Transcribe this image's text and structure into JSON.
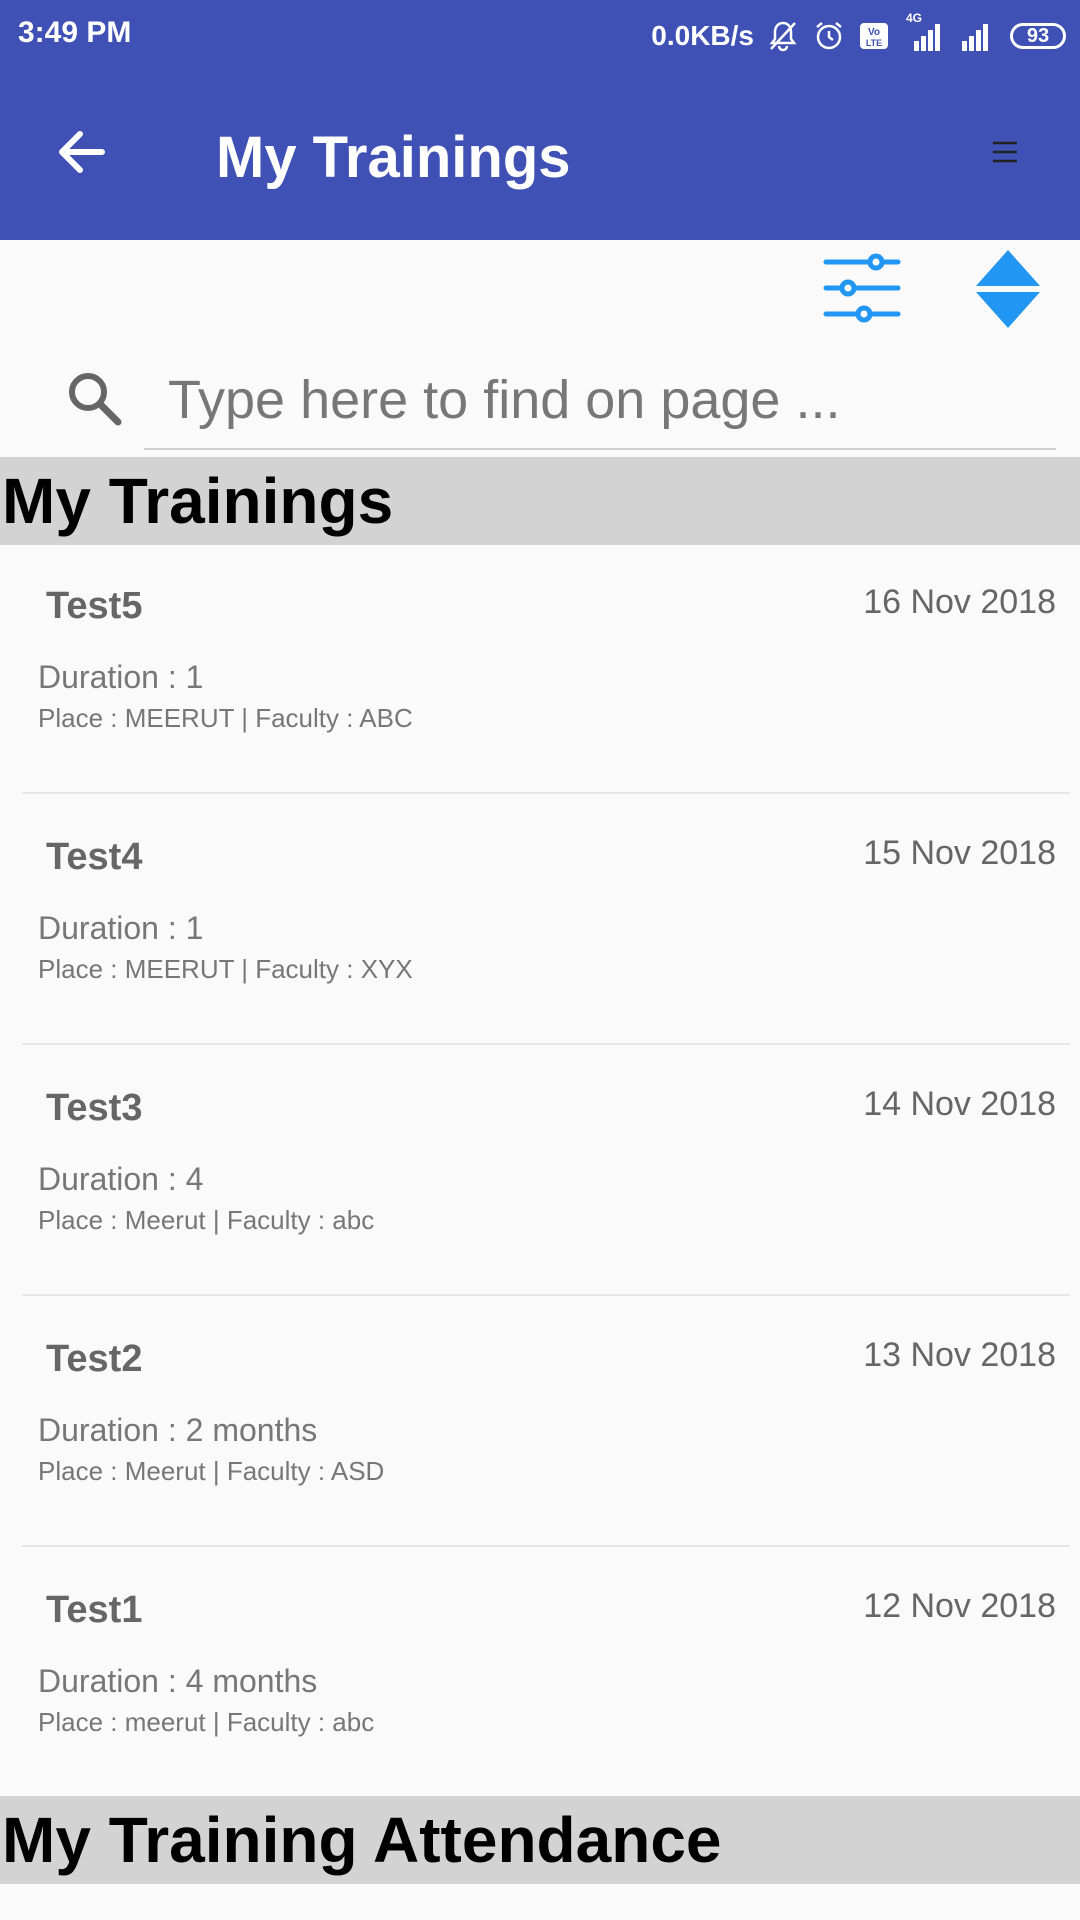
{
  "status_bar": {
    "time": "3:49 PM",
    "speed": "0.0KB/s",
    "network_label": "4G",
    "battery": "93",
    "icons": [
      "bell-muted-icon",
      "alarm-icon",
      "volte-icon",
      "signal-4g-icon",
      "signal-icon",
      "battery-icon"
    ]
  },
  "app_bar": {
    "title": "My Trainings",
    "back_icon": "arrow-left-icon",
    "menu_icon": "menu-icon"
  },
  "toolbar": {
    "filter_icon": "sliders-icon",
    "sort_icon": "sort-icon",
    "accent_color": "#2196f3"
  },
  "search": {
    "placeholder": "Type here to find on page ...",
    "value": ""
  },
  "sections": {
    "trainings_title": "My Trainings",
    "attendance_title": "My Training Attendance"
  },
  "trainings": [
    {
      "name": "Test5",
      "date": "16 Nov 2018",
      "duration": "Duration : 1",
      "meta": "Place : MEERUT | Faculty : ABC"
    },
    {
      "name": "Test4",
      "date": "15 Nov 2018",
      "duration": "Duration : 1",
      "meta": "Place : MEERUT | Faculty : XYX"
    },
    {
      "name": "Test3",
      "date": "14 Nov 2018",
      "duration": "Duration : 4",
      "meta": "Place : Meerut | Faculty : abc"
    },
    {
      "name": "Test2",
      "date": "13 Nov 2018",
      "duration": "Duration : 2 months",
      "meta": "Place : Meerut | Faculty : ASD"
    },
    {
      "name": "Test1",
      "date": "12 Nov 2018",
      "duration": "Duration : 4 months",
      "meta": "Place : meerut | Faculty : abc"
    }
  ],
  "colors": {
    "primary": "#3f51b5",
    "section_bg": "#d3d3d3",
    "background": "#fafafa"
  }
}
